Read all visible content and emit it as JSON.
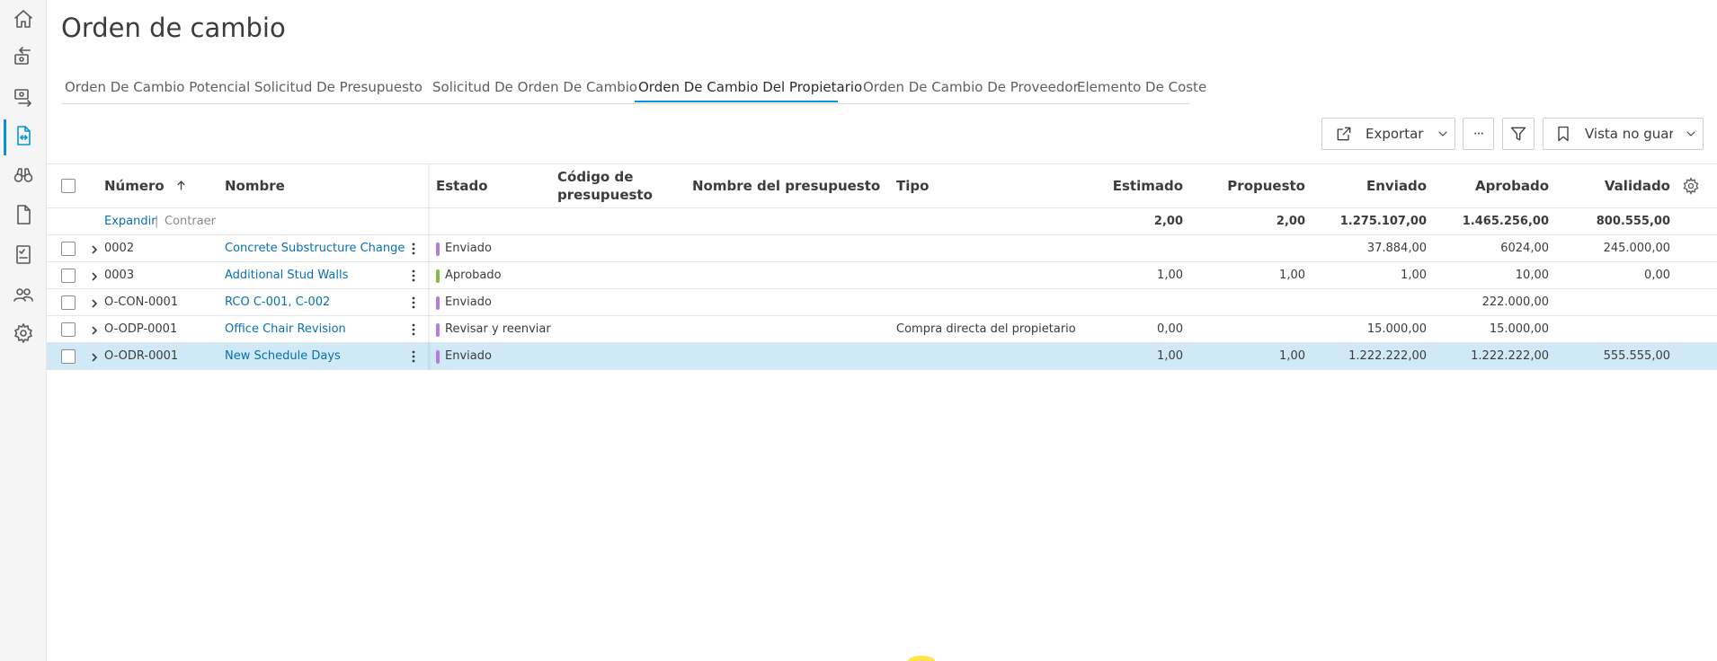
{
  "page": {
    "title": "Orden de cambio"
  },
  "sidebar": {
    "items": [
      {
        "icon": "home-icon"
      },
      {
        "icon": "change-in-icon"
      },
      {
        "icon": "change-out-icon"
      },
      {
        "icon": "change-order-icon"
      },
      {
        "icon": "binoculars-icon"
      },
      {
        "icon": "document-icon"
      },
      {
        "icon": "checklist-icon"
      },
      {
        "icon": "members-icon"
      },
      {
        "icon": "settings-icon"
      }
    ],
    "active_color": "#0696d7"
  },
  "tabs": [
    {
      "label": "Orden De Cambio Potencial"
    },
    {
      "label": "Solicitud De Presupuesto"
    },
    {
      "label": "Solicitud De Orden De Cambio"
    },
    {
      "label": "Orden De Cambio Del Propietario"
    },
    {
      "label": "Orden De Cambio De Proveedor"
    },
    {
      "label": "Elemento De Coste"
    }
  ],
  "toolbar": {
    "export_label": "Exportar",
    "more_label": "···",
    "view_label": "Vista no guardа"
  },
  "table": {
    "columns": {
      "number": "Número",
      "name": "Nombre",
      "status": "Estado",
      "budget_code_1": "Código de",
      "budget_code_2": "presupuesto",
      "budget_name": "Nombre del presupuesto",
      "type": "Tipo",
      "estimated": "Estimado",
      "proposed": "Propuesto",
      "sent": "Enviado",
      "approved": "Aprobado",
      "validated": "Validado"
    },
    "expand_label": "Expandir",
    "separator": "|",
    "collapse_label": "Contraer",
    "totals": {
      "estimated": "2,00",
      "proposed": "2,00",
      "sent": "1.275.107,00",
      "approved": "1.465.256,00",
      "validated": "800.555,00"
    },
    "rows": [
      {
        "number": "0002",
        "name": "Concrete Substructure Change",
        "status": "Enviado",
        "status_color": "#b57be8",
        "type": "",
        "estimated": "",
        "proposed": "",
        "sent": "37.884,00",
        "approved": "6024,00",
        "validated": "245.000,00"
      },
      {
        "number": "0003",
        "name": "Additional Stud Walls",
        "status": "Aprobado",
        "status_color": "#87bc40",
        "type": "",
        "estimated": "1,00",
        "proposed": "1,00",
        "sent": "1,00",
        "approved": "10,00",
        "validated": "0,00"
      },
      {
        "number": "O-CON-0001",
        "name": "RCO C-001, C-002",
        "status": "Enviado",
        "status_color": "#b57be8",
        "type": "",
        "estimated": "",
        "proposed": "",
        "sent": "",
        "approved": "222.000,00",
        "validated": ""
      },
      {
        "number": "O-ODP-0001",
        "name": "Office Chair Revision",
        "status": "Revisar y reenviar",
        "status_color": "#b57be8",
        "type": "Compra directa del propietario",
        "estimated": "0,00",
        "proposed": "",
        "sent": "15.000,00",
        "approved": "15.000,00",
        "validated": ""
      },
      {
        "number": "O-ODR-0001",
        "name": "New Schedule Days",
        "status": "Enviado",
        "status_color": "#b57be8",
        "type": "",
        "estimated": "1,00",
        "proposed": "1,00",
        "sent": "1.222.222,00",
        "approved": "1.222.222,00",
        "validated": "555.555,00"
      }
    ],
    "selected_row_index": 4
  }
}
